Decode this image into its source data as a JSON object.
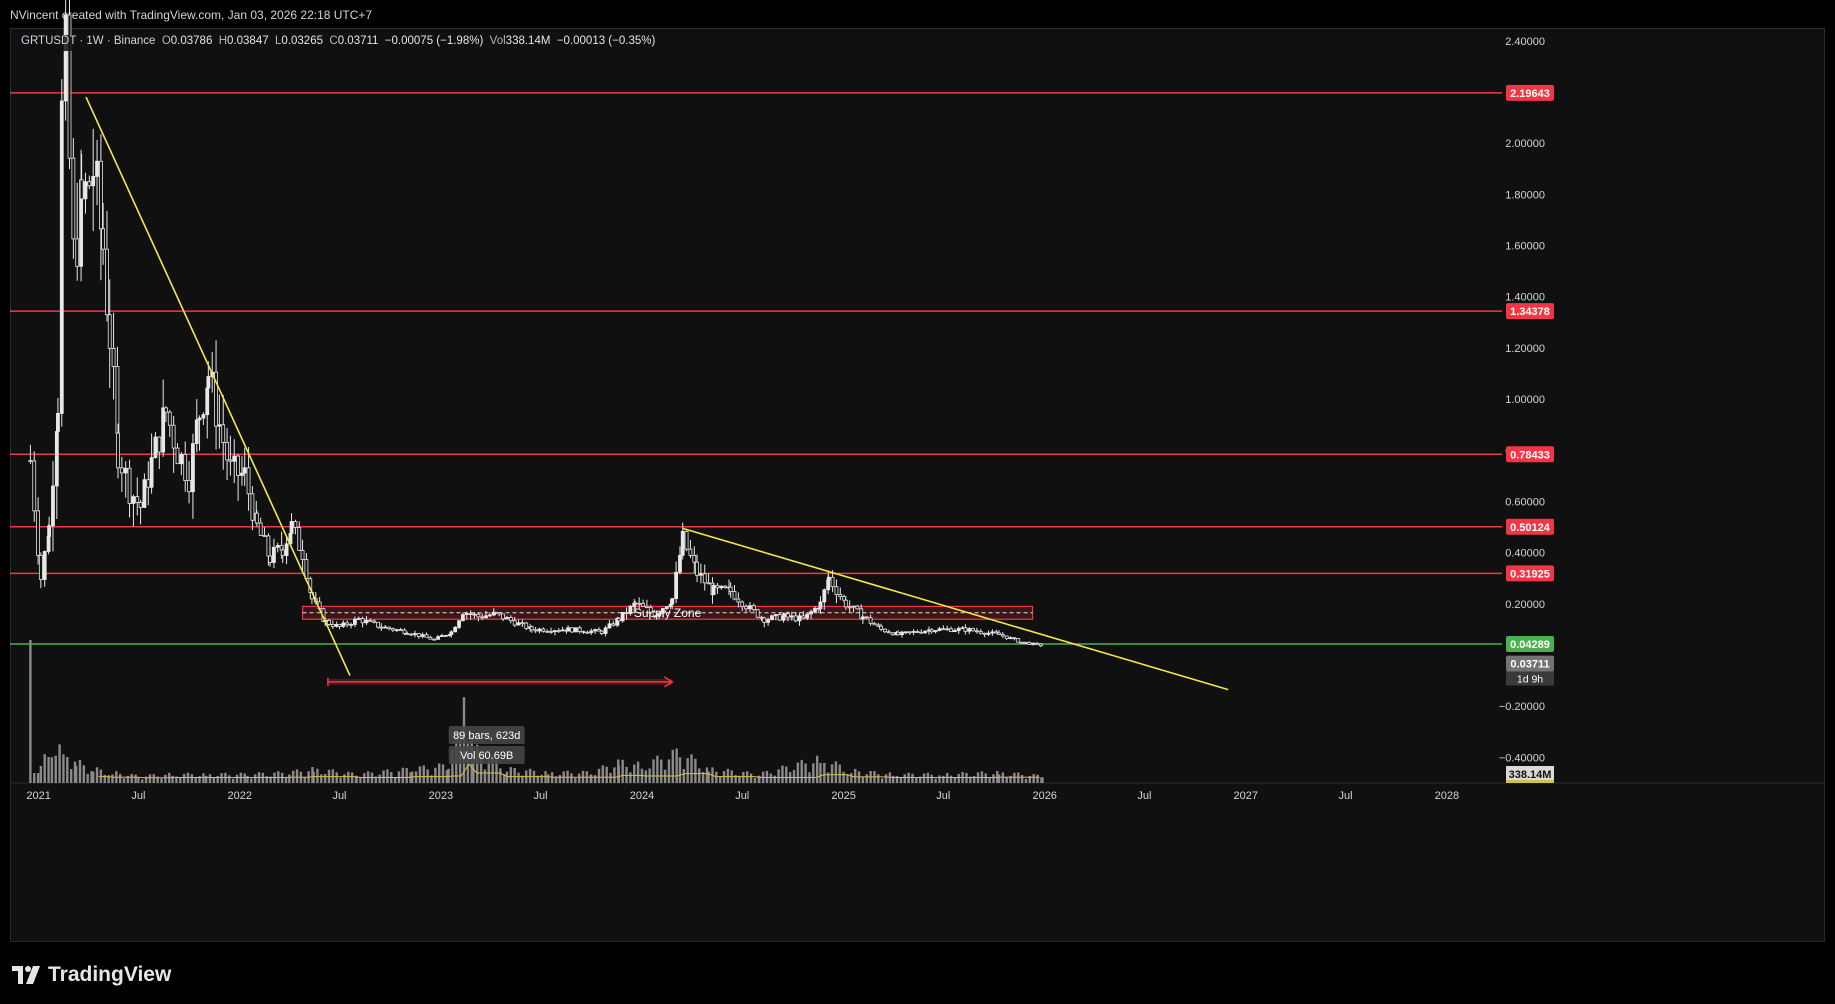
{
  "header": {
    "text": "NVincent created with TradingView.com, Jan 03, 2026 22:18 UTC+7"
  },
  "legend": {
    "symbol": "GRTUSDT · 1W · Binance",
    "open_label": "O",
    "open": "0.03786",
    "high_label": "H",
    "high": "0.03847",
    "low_label": "L",
    "low": "0.03265",
    "close_label": "C",
    "close": "0.03711",
    "change": "−0.00075 (−1.98%)",
    "vol_label": "Vol",
    "vol": "338.14M",
    "vol_change": "−0.00013 (−0.35%)"
  },
  "footer": {
    "brand": "TradingView"
  },
  "colors": {
    "background": "#101010",
    "candle": "#e8e8e8",
    "resistance_line": "#f23645",
    "support_line": "#4caf50",
    "trendline": "#f5e74a",
    "volume_bar": "#8a8a8a",
    "volume_ma": "#d4c04a",
    "price_badge": "#737375"
  },
  "chart_data": {
    "type": "candlestick",
    "symbol": "GRTUSDT",
    "interval": "1W",
    "exchange": "Binance",
    "y_axis": {
      "ylim": [
        -0.5,
        2.45
      ],
      "ticks": [
        2.4,
        2.2,
        2.0,
        1.8,
        1.6,
        1.4,
        1.2,
        1.0,
        0.8,
        0.6,
        0.4,
        0.2,
        -0.2,
        -0.4
      ],
      "tick_labels": [
        "2.40000",
        "2.20000",
        "2.00000",
        "1.80000",
        "1.60000",
        "1.40000",
        "1.20000",
        "1.00000",
        "0.80000",
        "0.60000",
        "0.40000",
        "0.20000",
        "−0.20000",
        "−0.40000"
      ]
    },
    "x_axis": {
      "range": [
        "2020-11-10",
        "2028-04-10"
      ],
      "ticks": [
        {
          "date": "2021-01-01",
          "label": "2021"
        },
        {
          "date": "2021-07-01",
          "label": "Jul"
        },
        {
          "date": "2022-01-01",
          "label": "2022"
        },
        {
          "date": "2022-07-01",
          "label": "Jul"
        },
        {
          "date": "2023-01-01",
          "label": "2023"
        },
        {
          "date": "2023-07-01",
          "label": "Jul"
        },
        {
          "date": "2024-01-01",
          "label": "2024"
        },
        {
          "date": "2024-07-01",
          "label": "Jul"
        },
        {
          "date": "2025-01-01",
          "label": "2025"
        },
        {
          "date": "2025-07-01",
          "label": "Jul"
        },
        {
          "date": "2026-01-01",
          "label": "2026"
        },
        {
          "date": "2026-07-01",
          "label": "Jul"
        },
        {
          "date": "2027-01-01",
          "label": "2027"
        },
        {
          "date": "2027-07-01",
          "label": "Jul"
        },
        {
          "date": "2028-01-01",
          "label": "2028"
        }
      ]
    },
    "price_path": [
      [
        "2020-12-17",
        0.76
      ],
      [
        "2021-01-05",
        0.3
      ],
      [
        "2021-01-20",
        0.5
      ],
      [
        "2021-02-05",
        1.0
      ],
      [
        "2021-02-12",
        2.1
      ],
      [
        "2021-02-19",
        2.3
      ],
      [
        "2021-03-05",
        1.55
      ],
      [
        "2021-03-20",
        1.75
      ],
      [
        "2021-04-10",
        1.9
      ],
      [
        "2021-04-28",
        1.6
      ],
      [
        "2021-05-10",
        1.25
      ],
      [
        "2021-05-25",
        0.8
      ],
      [
        "2021-06-15",
        0.65
      ],
      [
        "2021-07-05",
        0.58
      ],
      [
        "2021-07-25",
        0.75
      ],
      [
        "2021-08-20",
        0.95
      ],
      [
        "2021-09-10",
        0.8
      ],
      [
        "2021-10-01",
        0.7
      ],
      [
        "2021-10-20",
        0.95
      ],
      [
        "2021-11-05",
        1.1
      ],
      [
        "2021-11-25",
        0.9
      ],
      [
        "2021-12-15",
        0.72
      ],
      [
        "2022-01-10",
        0.7
      ],
      [
        "2022-02-01",
        0.5
      ],
      [
        "2022-02-25",
        0.38
      ],
      [
        "2022-03-20",
        0.42
      ],
      [
        "2022-04-05",
        0.5
      ],
      [
        "2022-04-25",
        0.4
      ],
      [
        "2022-05-12",
        0.22
      ],
      [
        "2022-06-05",
        0.13
      ],
      [
        "2022-07-01",
        0.11
      ],
      [
        "2022-08-05",
        0.14
      ],
      [
        "2022-09-15",
        0.11
      ],
      [
        "2022-11-01",
        0.09
      ],
      [
        "2022-12-20",
        0.06
      ],
      [
        "2023-01-20",
        0.09
      ],
      [
        "2023-02-10",
        0.17
      ],
      [
        "2023-03-10",
        0.15
      ],
      [
        "2023-04-10",
        0.16
      ],
      [
        "2023-06-15",
        0.1
      ],
      [
        "2023-08-20",
        0.1
      ],
      [
        "2023-10-20",
        0.09
      ],
      [
        "2023-11-20",
        0.14
      ],
      [
        "2023-12-20",
        0.2
      ],
      [
        "2024-01-25",
        0.16
      ],
      [
        "2024-02-25",
        0.22
      ],
      [
        "2024-03-15",
        0.45
      ],
      [
        "2024-04-10",
        0.32
      ],
      [
        "2024-05-10",
        0.25
      ],
      [
        "2024-06-10",
        0.25
      ],
      [
        "2024-07-15",
        0.18
      ],
      [
        "2024-08-10",
        0.14
      ],
      [
        "2024-09-15",
        0.15
      ],
      [
        "2024-10-20",
        0.14
      ],
      [
        "2024-11-20",
        0.2
      ],
      [
        "2024-12-05",
        0.3
      ],
      [
        "2025-01-05",
        0.2
      ],
      [
        "2025-02-05",
        0.15
      ],
      [
        "2025-03-10",
        0.1
      ],
      [
        "2025-04-10",
        0.08
      ],
      [
        "2025-06-10",
        0.1
      ],
      [
        "2025-08-10",
        0.1
      ],
      [
        "2025-10-10",
        0.08
      ],
      [
        "2025-11-20",
        0.05
      ],
      [
        "2025-12-28",
        0.037
      ]
    ],
    "horizontal_levels": [
      {
        "price": 2.19643,
        "label": "2.19643",
        "kind": "resistance"
      },
      {
        "price": 1.34378,
        "label": "1.34378",
        "kind": "resistance"
      },
      {
        "price": 0.78433,
        "label": "0.78433",
        "kind": "resistance"
      },
      {
        "price": 0.50124,
        "label": "0.50124",
        "kind": "resistance"
      },
      {
        "price": 0.31925,
        "label": "0.31925",
        "kind": "resistance"
      },
      {
        "price": 0.04289,
        "label": "0.04289",
        "kind": "support"
      }
    ],
    "trendlines": [
      {
        "from": [
          "2021-03-28",
          2.18
        ],
        "to": [
          "2022-07-20",
          -0.08
        ]
      },
      {
        "from": [
          "2024-03-15",
          0.495
        ],
        "to": [
          "2026-11-30",
          -0.135
        ]
      }
    ],
    "supply_zone": {
      "label": "Supply Zone",
      "from_date": "2022-04-25",
      "to_date": "2025-12-10",
      "low": 0.14,
      "high": 0.19,
      "mid": 0.165
    },
    "measure": {
      "bars_text": "89 bars, 623d",
      "vol_text": "Vol 60.69B",
      "from_date": "2022-06-10",
      "to_date": "2024-02-25",
      "price": -0.105
    },
    "last_price": {
      "value": "0.03711",
      "countdown": "1d 9h",
      "date": "2025-12-28"
    },
    "volume": {
      "last_label": "338.14M",
      "bars": [
        {
          "date": "2020-12-17",
          "v": 1.0
        },
        {
          "date": "2021-01-05",
          "v": 0.12
        },
        {
          "date": "2021-01-25",
          "v": 0.18
        },
        {
          "date": "2021-02-15",
          "v": 0.2
        },
        {
          "date": "2021-03-10",
          "v": 0.12
        },
        {
          "date": "2021-04-10",
          "v": 0.08
        },
        {
          "date": "2021-05-15",
          "v": 0.06
        },
        {
          "date": "2021-07-01",
          "v": 0.04
        },
        {
          "date": "2021-09-01",
          "v": 0.05
        },
        {
          "date": "2021-11-01",
          "v": 0.05
        },
        {
          "date": "2022-01-15",
          "v": 0.05
        },
        {
          "date": "2022-04-01",
          "v": 0.06
        },
        {
          "date": "2022-05-15",
          "v": 0.08
        },
        {
          "date": "2022-08-01",
          "v": 0.05
        },
        {
          "date": "2022-11-10",
          "v": 0.08
        },
        {
          "date": "2023-01-15",
          "v": 0.1
        },
        {
          "date": "2023-02-12",
          "v": 0.6
        },
        {
          "date": "2023-03-01",
          "v": 0.2
        },
        {
          "date": "2023-05-01",
          "v": 0.08
        },
        {
          "date": "2023-07-15",
          "v": 0.06
        },
        {
          "date": "2023-10-01",
          "v": 0.06
        },
        {
          "date": "2023-11-20",
          "v": 0.12
        },
        {
          "date": "2024-01-01",
          "v": 0.1
        },
        {
          "date": "2024-03-10",
          "v": 0.18
        },
        {
          "date": "2024-05-01",
          "v": 0.08
        },
        {
          "date": "2024-08-01",
          "v": 0.05
        },
        {
          "date": "2024-11-20",
          "v": 0.14
        },
        {
          "date": "2025-01-15",
          "v": 0.07
        },
        {
          "date": "2025-04-01",
          "v": 0.05
        },
        {
          "date": "2025-07-01",
          "v": 0.05
        },
        {
          "date": "2025-10-10",
          "v": 0.06
        },
        {
          "date": "2025-12-28",
          "v": 0.04
        }
      ]
    }
  }
}
